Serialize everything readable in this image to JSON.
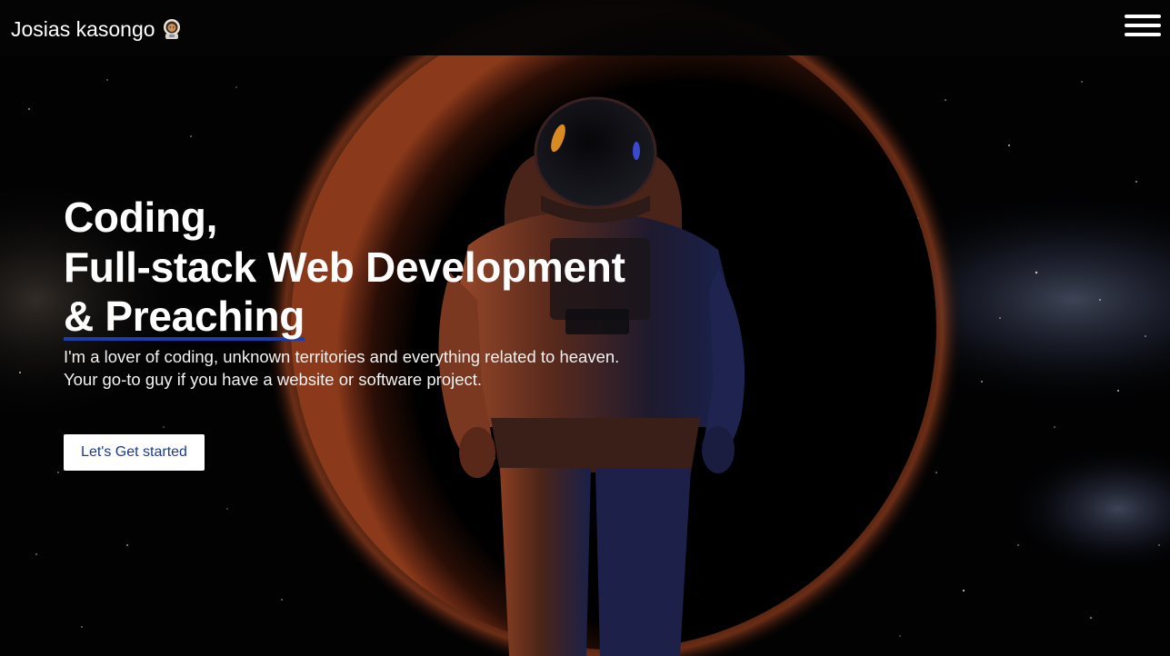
{
  "navbar": {
    "brand_name": "Josias kasongo",
    "brand_icon": "astronaut-emoji-icon",
    "menu_icon": "hamburger-menu-icon"
  },
  "hero": {
    "title_lines": [
      "Coding,",
      "Full-stack Web Development",
      "& Preaching"
    ],
    "subtitle_lines": [
      "I'm a lover of coding, unknown territories and everything related to heaven.",
      "Your go-to guy if you have a website or software project."
    ],
    "cta_label": "Let's Get started"
  },
  "colors": {
    "background": "#000000",
    "accent_underline": "#1c3ea8",
    "cta_text": "#1a3a8f",
    "cta_background": "#ffffff",
    "text": "#ffffff"
  }
}
